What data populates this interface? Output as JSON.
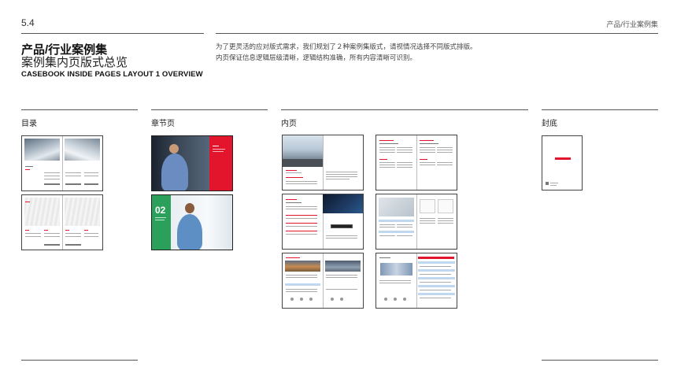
{
  "header": {
    "section_number": "5.4",
    "section_title": "产品/行业案例集"
  },
  "title": {
    "main": "产品/行业案例集",
    "sub": "案例集内页版式总览",
    "english": "CASEBOOK INSIDE PAGES LAYOUT 1 OVERVIEW"
  },
  "description": {
    "line1": "为了更灵活的应对版式需求，我们规划了２种案例集版式，请视情况选择不同版式排版。",
    "line2": "内页保证信息逻辑层级清晰，逻辑结构准确，所有内容清晰可识别。"
  },
  "columns": {
    "toc": "目录",
    "chapter": "章节页",
    "inner": "内页",
    "back_cover": "封底"
  },
  "chapter_page": {
    "number": "02"
  },
  "colors": {
    "brand_red": "#e3152d",
    "chapter_green": "#2aa05a"
  }
}
